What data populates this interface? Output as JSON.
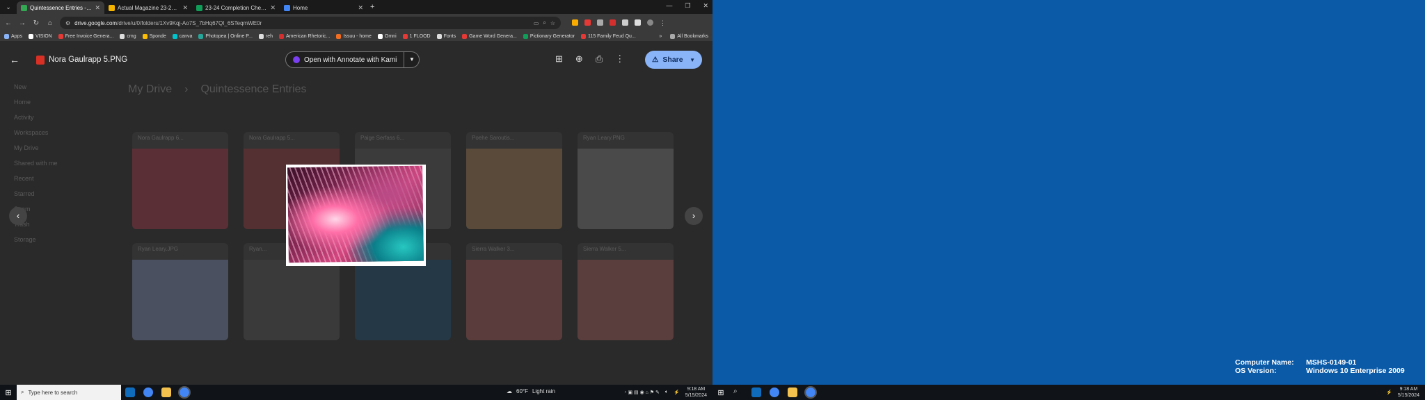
{
  "browser": {
    "tabs": [
      {
        "title": "Quintessence Entries - Google",
        "color": "#34a853",
        "active": true
      },
      {
        "title": "Actual Magazine 23-24 - Goog",
        "color": "#f4b400",
        "active": false
      },
      {
        "title": "23-24 Completion Check - Goo",
        "color": "#0f9d58",
        "active": false
      },
      {
        "title": "Home",
        "color": "#4285f4",
        "active": false
      }
    ],
    "new_tab": "+",
    "url_host": "drive.google.com",
    "url_path": "/drive/u/0/folders/1Xv9Kqj-Ao7S_7bHq67QI_6STeqmWE0r",
    "bookmarks": [
      {
        "label": "Apps",
        "color": "#8ab4f8"
      },
      {
        "label": "VISION",
        "color": "#fff"
      },
      {
        "label": "Free Invoice Genera...",
        "color": "#e53935"
      },
      {
        "label": "cmg",
        "color": "#ddd"
      },
      {
        "label": "Sponde",
        "color": "#fbbc04"
      },
      {
        "label": "canva",
        "color": "#00c4cc"
      },
      {
        "label": "Photopea | Online P...",
        "color": "#26a69a"
      },
      {
        "label": "reh",
        "color": "#ddd"
      },
      {
        "label": "American Rhetoric...",
        "color": "#d32f2f"
      },
      {
        "label": "Issuu - home",
        "color": "#f36d21"
      },
      {
        "label": "Omni",
        "color": "#fff"
      },
      {
        "label": "1 FLOOD",
        "color": "#e53935"
      },
      {
        "label": "Fonts",
        "color": "#ddd"
      },
      {
        "label": "Game Word Genera...",
        "color": "#e53935"
      },
      {
        "label": "Pictionary Generator",
        "color": "#0f9d58"
      },
      {
        "label": "115 Family Feud Qu...",
        "color": "#e53935"
      }
    ],
    "all_bookmarks": "All Bookmarks"
  },
  "drive": {
    "sidebar": [
      "New",
      "Home",
      "Activity",
      "Workspaces",
      "My Drive",
      "Shared with me",
      "Recent",
      "Starred",
      "Spam",
      "Trash",
      "Storage"
    ],
    "breadcrumb": [
      "My Drive",
      "Quintessence Entries"
    ],
    "files": [
      {
        "name": "Nora Gaulrapp 6...",
        "thumb": "#5a2f35"
      },
      {
        "name": "Nora Gaulrapp 5...",
        "thumb": "#553032"
      },
      {
        "name": "Paige Serfass 6...",
        "thumb": "#3b3b3b"
      },
      {
        "name": "Poehe Saroutis...",
        "thumb": "#5a4a3a"
      },
      {
        "name": "Ryan Leary.PNG",
        "thumb": "#4a4a4a"
      },
      {
        "name": "Ryan Leary.JPG",
        "thumb": "#4a5060"
      },
      {
        "name": "Ryan...",
        "thumb": "#3a3a3a"
      },
      {
        "name": "",
        "thumb": "#243845"
      },
      {
        "name": "Sierra Walker 3...",
        "thumb": "#5a3c3c"
      },
      {
        "name": "Sierra Walker 5...",
        "thumb": "#5a3e3e"
      }
    ]
  },
  "viewer": {
    "filename": "Nora Gaulrapp 5.PNG",
    "open_with": "Open with Annotate with Kami",
    "share": "Share"
  },
  "taskbar_left": {
    "search_placeholder": "Type here to search",
    "weather_temp": "60°F",
    "weather_desc": "Light rain",
    "time": "9:18 AM",
    "date": "5/15/2024"
  },
  "taskbar_right": {
    "time": "9:18 AM",
    "date": "5/15/2024"
  },
  "sysinfo": {
    "computer_name_label": "Computer Name:",
    "computer_name": "MSHS-0149-01",
    "os_label": "OS Version:",
    "os": "Windows 10 Enterprise 2009"
  },
  "colors": {
    "desktop": "#0a5aa8",
    "share_button": "#8ab4f8"
  }
}
